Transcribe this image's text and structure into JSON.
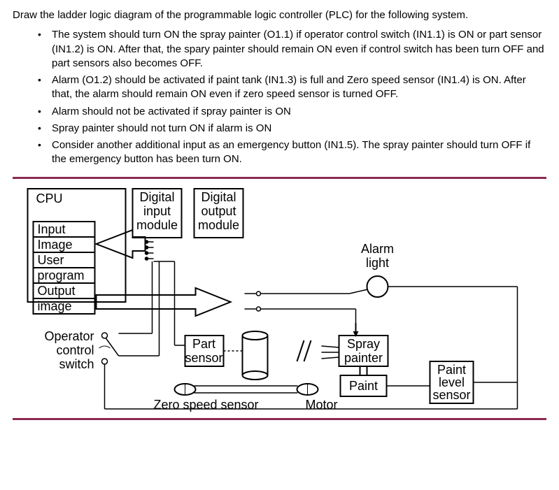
{
  "intro": "Draw the ladder logic diagram of the programmable logic controller (PLC) for the following system.",
  "bullets": [
    "The system should turn ON the spray painter (O1.1) if operator control switch (IN1.1) is ON or part sensor (IN1.2) is ON. After that, the spary painter should remain ON even if control switch has been turn OFF and part sensors also becomes OFF.",
    "Alarm (O1.2) should be activated if paint tank (IN1.3) is full and Zero speed sensor (IN1.4) is ON. After that, the alarm should remain ON even if zero speed sensor is turned OFF.",
    "Alarm should not be activated if spray painter is ON",
    "Spray painter should not turn ON if alarm is ON",
    "Consider another additional input as an emergency button (IN1.5). The spray painter should turn OFF if the emergency button has been turn ON."
  ],
  "diag": {
    "cpu": "CPU",
    "input_image": "Input",
    "image": "Image",
    "user": "User",
    "program": "program",
    "output": "Output",
    "output_image": "image",
    "din": [
      "Digital",
      "input",
      "module"
    ],
    "dout": [
      "Digital",
      "output",
      "module"
    ],
    "alarm_l1": "Alarm",
    "alarm_l2": "light",
    "op_l1": "Operator",
    "op_l2": "control",
    "op_l3": "switch",
    "part_l1": "Part",
    "part_l2": "sensor",
    "spray_l1": "Spray",
    "spray_l2": "painter",
    "paint": "Paint",
    "pls_l1": "Paint",
    "pls_l2": "level",
    "pls_l3": "sensor",
    "zero_speed": "Zero speed sensor",
    "motor": "Motor"
  }
}
